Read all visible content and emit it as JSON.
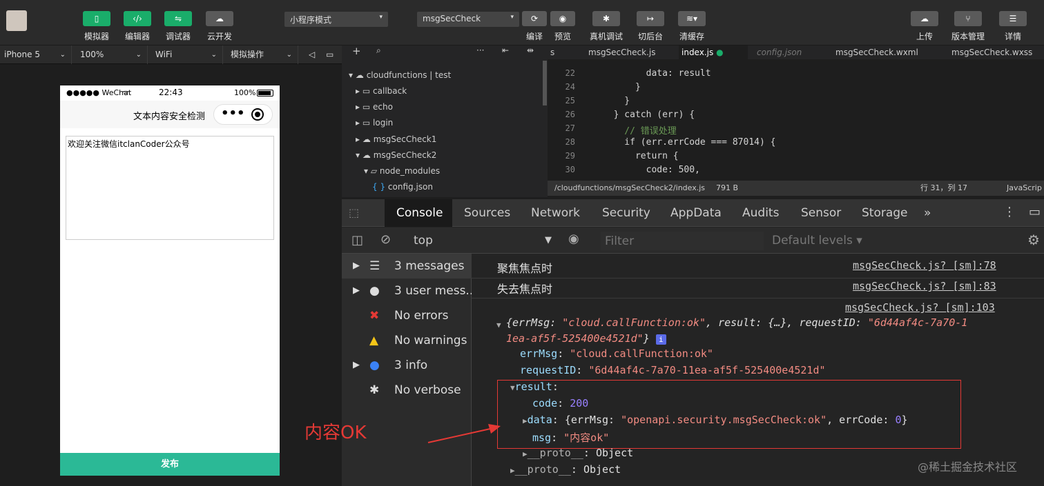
{
  "toolbar": {
    "buttons": [
      {
        "label": "模拟器"
      },
      {
        "label": "编辑器"
      },
      {
        "label": "调试器"
      },
      {
        "label": "云开发"
      }
    ],
    "mode_select": "小程序模式",
    "compile_select": "msgSecCheck",
    "actions": [
      {
        "label": "编译"
      },
      {
        "label": "预览"
      },
      {
        "label": "真机调试"
      },
      {
        "label": "切后台"
      },
      {
        "label": "清缓存"
      }
    ],
    "right_actions": [
      {
        "label": "上传"
      },
      {
        "label": "版本管理"
      },
      {
        "label": "详情"
      }
    ]
  },
  "devbar": {
    "device": "iPhone 5",
    "zoom": "100%",
    "network": "WiFi",
    "ops": "模拟操作"
  },
  "phone": {
    "carrier": "●●●●● WeChat",
    "time": "22:43",
    "battery": "100%",
    "title": "文本内容安全检测",
    "textarea_value": "欢迎关注微信itclanCoder公众号",
    "publish": "发布"
  },
  "tree": {
    "root": "cloudfunctions | test",
    "items": [
      {
        "label": "callback"
      },
      {
        "label": "echo"
      },
      {
        "label": "login"
      },
      {
        "label": "msgSecCheck1"
      },
      {
        "label": "msgSecCheck2"
      },
      {
        "label": "node_modules"
      },
      {
        "label": "config.json"
      }
    ]
  },
  "editor": {
    "tabs": [
      {
        "label": "s"
      },
      {
        "label": "msgSecCheck.js"
      },
      {
        "label": "index.js"
      },
      {
        "label": "config.json"
      },
      {
        "label": "msgSecCheck.wxml"
      },
      {
        "label": "msgSecCheck.wxss"
      }
    ],
    "lines": [
      {
        "num": "22",
        "code": "        data: result"
      },
      {
        "num": "24",
        "code": "      }"
      },
      {
        "num": "25",
        "code": "    }"
      },
      {
        "num": "26",
        "code": "  } catch (err) {"
      },
      {
        "num": "27",
        "code": "    // 错误处理"
      },
      {
        "num": "28",
        "code": "    if (err.errCode === 87014) {"
      },
      {
        "num": "29",
        "code": "      return {"
      },
      {
        "num": "30",
        "code": "        code: 500,"
      }
    ],
    "status_path": "/cloudfunctions/msgSecCheck2/index.js",
    "status_size": "791 B",
    "status_pos": "行 31，列 17",
    "status_lang": "JavaScrip"
  },
  "devtools": {
    "tabs": [
      {
        "label": "Console"
      },
      {
        "label": "Sources"
      },
      {
        "label": "Network"
      },
      {
        "label": "Security"
      },
      {
        "label": "AppData"
      },
      {
        "label": "Audits"
      },
      {
        "label": "Sensor"
      },
      {
        "label": "Storage"
      },
      {
        "label": "»"
      }
    ],
    "context": "top",
    "filter_placeholder": "Filter",
    "levels": "Default levels ▾",
    "sidebar": [
      {
        "label": "3 messages"
      },
      {
        "label": "3 user mess..."
      },
      {
        "label": "No errors"
      },
      {
        "label": "No warnings"
      },
      {
        "label": "3 info"
      },
      {
        "label": "No verbose"
      }
    ],
    "messages": [
      {
        "text": "聚焦焦点时",
        "src": "msgSecCheck.js? [sm]:78"
      },
      {
        "text": "失去焦点时",
        "src": "msgSecCheck.js? [sm]:83"
      }
    ],
    "src103": "msgSecCheck.js? [sm]:103",
    "obj": {
      "summary_a": "{errMsg: ",
      "summary_b": "\"cloud.callFunction:ok\"",
      "summary_c": ", result: {…}, requestID: ",
      "summary_d": "\"6d44af4c-7a70-1",
      "summary_e": "1ea-af5f-525400e4521d\"",
      "summary_f": "}",
      "errMsg_key": "errMsg",
      "errMsg_val": "\"cloud.callFunction:ok\"",
      "requestID_key": "requestID",
      "requestID_val": "\"6d44af4c-7a70-11ea-af5f-525400e4521d\"",
      "result_key": "result",
      "code_key": "code",
      "code_val": "200",
      "data_key": "data",
      "data_a": "{errMsg: ",
      "data_b": "\"openapi.security.msgSecCheck:ok\"",
      "data_c": ", errCode: ",
      "data_d": "0",
      "data_e": "}",
      "msg_key": "msg",
      "msg_val": "\"内容ok\"",
      "proto1": "__proto__",
      "proto1_val": ": Object",
      "proto2": "__proto__",
      "proto2_val": ": Object"
    },
    "annotation": "内容OK",
    "watermark": "@稀土掘金技术社区"
  },
  "colors": {
    "accent": "#1aad6a",
    "publish": "#2bb996",
    "annotation_red": "#e53935"
  }
}
